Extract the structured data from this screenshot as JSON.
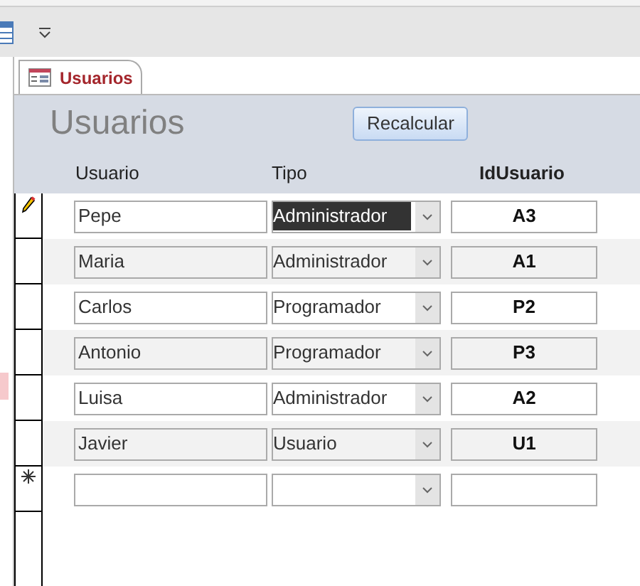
{
  "tab": {
    "label": "Usuarios",
    "selected": true
  },
  "form": {
    "title": "Usuarios",
    "button": "Recalcular",
    "columns": [
      "Usuario",
      "Tipo",
      "IdUsuario"
    ],
    "rows": [
      {
        "kind": "editing",
        "usuario": "Pepe",
        "tipo": "Administrador",
        "tipo_highlighted": true,
        "id": "A3"
      },
      {
        "kind": "saved",
        "usuario": "Maria",
        "tipo": "Administrador",
        "tipo_highlighted": false,
        "id": "A1"
      },
      {
        "kind": "saved",
        "usuario": "Carlos",
        "tipo": "Programador",
        "tipo_highlighted": false,
        "id": "P2"
      },
      {
        "kind": "saved",
        "usuario": "Antonio",
        "tipo": "Programador",
        "tipo_highlighted": false,
        "id": "P3"
      },
      {
        "kind": "saved",
        "usuario": "Luisa",
        "tipo": "Administrador",
        "tipo_highlighted": false,
        "id": "A2"
      },
      {
        "kind": "saved",
        "usuario": "Javier",
        "tipo": "Usuario",
        "tipo_highlighted": false,
        "id": "U1"
      },
      {
        "kind": "new"
      }
    ]
  }
}
